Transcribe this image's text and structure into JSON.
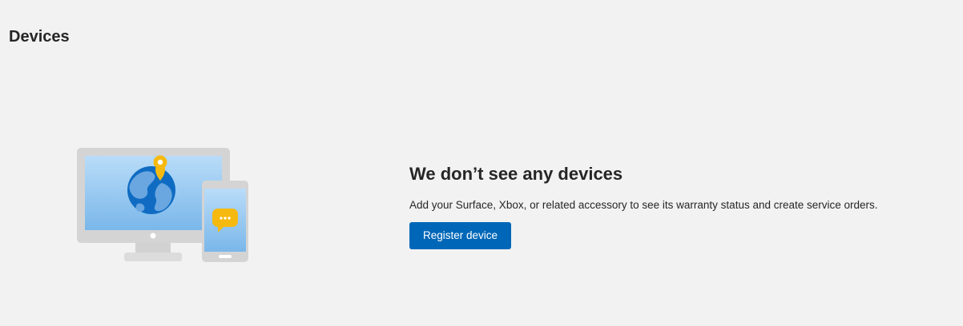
{
  "page": {
    "title": "Devices"
  },
  "empty_state": {
    "title": "We don’t see any devices",
    "description": "Add your Surface, Xbox, or related accessory to see its warranty status and create service orders.",
    "register_button_label": "Register device"
  },
  "colors": {
    "background": "#f2f2f2",
    "accent_button": "#0067b8",
    "text": "#262626",
    "illustration_screen": "#a7d1f4",
    "illustration_globe": "#0f6cc2",
    "illustration_pin": "#f6b90f"
  },
  "icons": {
    "illustration": "devices-illustration-icon"
  }
}
